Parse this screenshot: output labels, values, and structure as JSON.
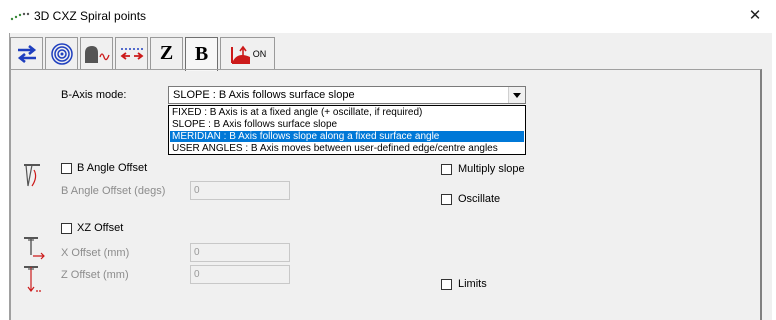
{
  "window": {
    "title": "3D CXZ Spiral points",
    "close_glyph": "✕"
  },
  "tabs": [
    {
      "icon": "swap-arrows-icon"
    },
    {
      "icon": "spiral-icon"
    },
    {
      "icon": "surface-profile-icon"
    },
    {
      "icon": "points-arrows-icon"
    },
    {
      "icon": "z-axis-icon",
      "text": "Z"
    },
    {
      "icon": "b-axis-icon",
      "text": "B"
    },
    {
      "icon": "limits-on-icon",
      "text": "ON"
    }
  ],
  "b_axis": {
    "label": "B-Axis mode:",
    "selected": "SLOPE :  B Axis follows surface slope",
    "options": [
      "FIXED :  B Axis is at a fixed angle (+ oscillate, if required)",
      "SLOPE :  B Axis follows surface slope",
      "MERIDIAN :  B Axis follows slope along a fixed surface angle",
      "USER ANGLES :  B Axis moves between user-defined edge/centre angles"
    ],
    "highlighted_index": 2
  },
  "b_angle": {
    "checkbox_label": "B Angle Offset",
    "field_label": "B Angle Offset (degs)",
    "field_value": "0"
  },
  "xz": {
    "checkbox_label": "XZ Offset",
    "x_label": "X Offset (mm)",
    "x_value": "0",
    "z_label": "Z Offset (mm)",
    "z_value": "0"
  },
  "options": {
    "multiply_slope": "Multiply slope",
    "oscillate": "Oscillate",
    "limits": "Limits"
  },
  "colors": {
    "selection": "#0078d7",
    "tab_blue": "#1f3fbf",
    "tab_red": "#cc1a1a"
  }
}
